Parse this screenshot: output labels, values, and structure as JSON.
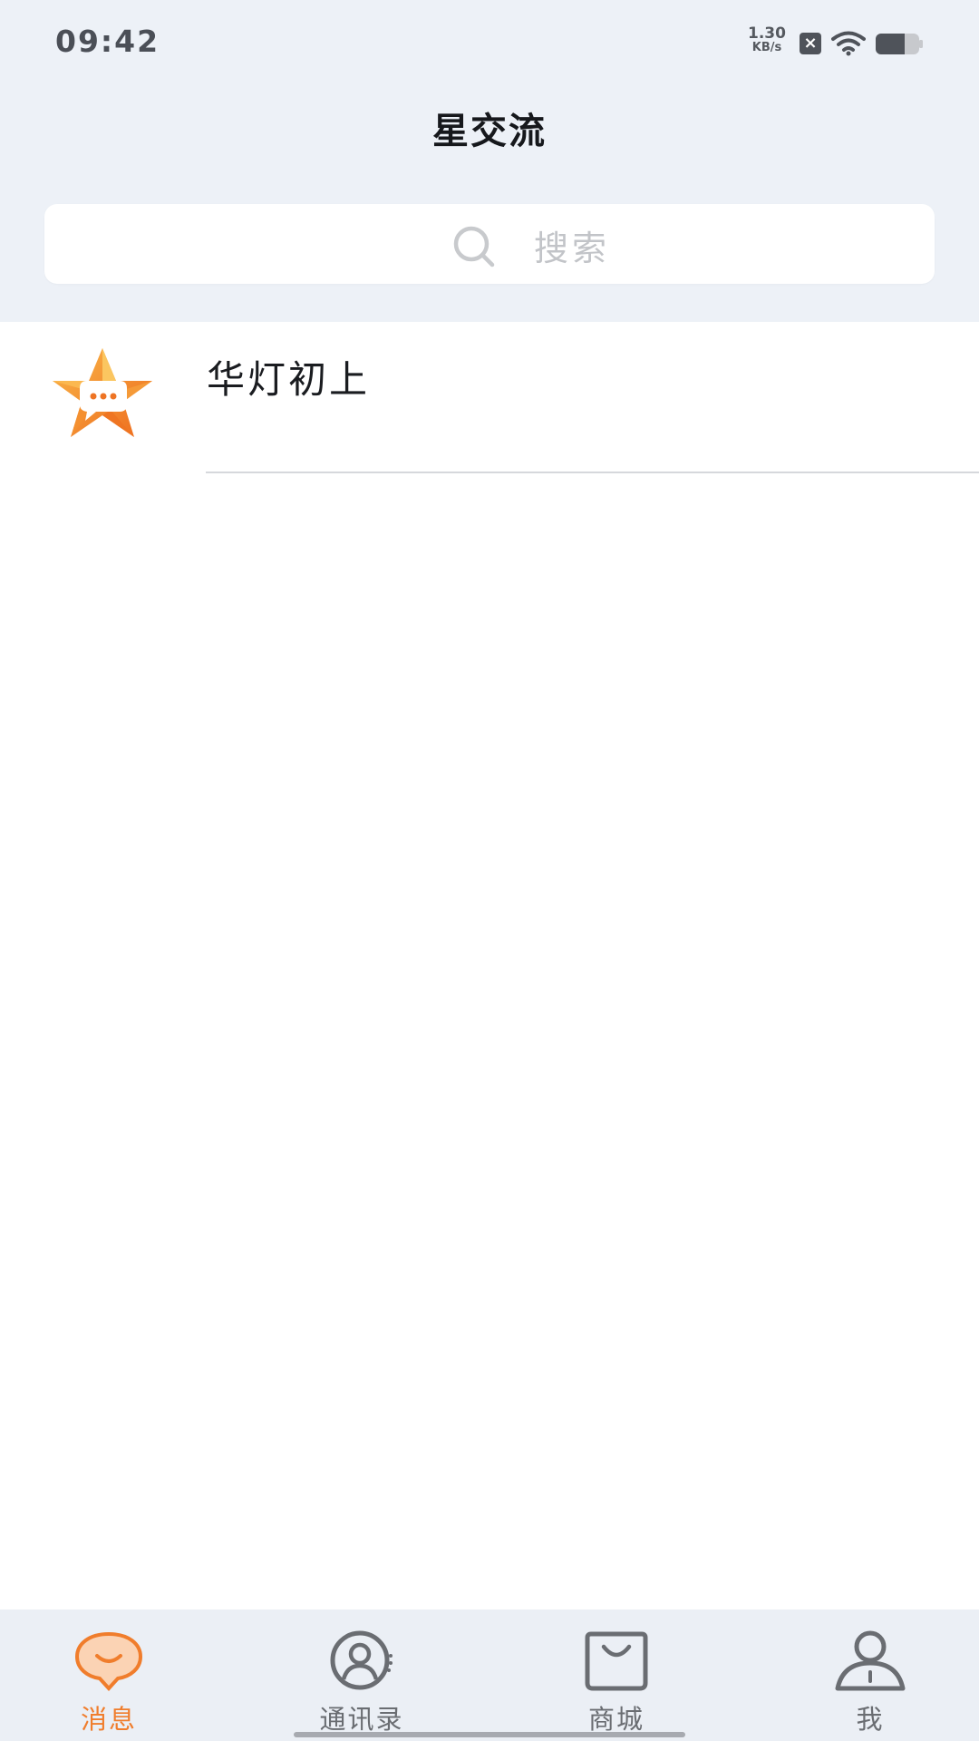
{
  "status_bar": {
    "time": "09:42",
    "net_speed_value": "1.30",
    "net_speed_unit": "KB/s",
    "icons": [
      "sim-no-service-icon",
      "wifi-icon",
      "battery-icon"
    ]
  },
  "header": {
    "title": "星交流"
  },
  "search": {
    "placeholder": "搜索",
    "icon": "search-icon"
  },
  "conversations": [
    {
      "name": "华灯初上",
      "avatar_icon": "star-chat-logo-icon"
    }
  ],
  "tabs": [
    {
      "label": "消息",
      "icon": "message-icon",
      "active": true
    },
    {
      "label": "通讯录",
      "icon": "contacts-icon",
      "active": false
    },
    {
      "label": "商城",
      "icon": "shopping-bag-icon",
      "active": false
    },
    {
      "label": "我",
      "icon": "profile-icon",
      "active": false
    }
  ],
  "colors": {
    "accent": "#f07d2c",
    "header_bg": "#edf1f7",
    "tab_bg": "#ebeff5",
    "inactive_tab": "#6a6d72"
  }
}
